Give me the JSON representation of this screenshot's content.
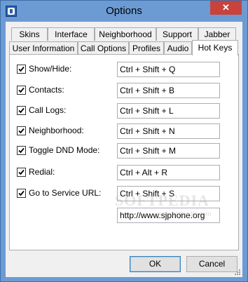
{
  "window": {
    "title": "Options",
    "close_label": "✕"
  },
  "tabs_back": [
    "Skins",
    "Interface",
    "Neighborhood",
    "Support",
    "Jabber"
  ],
  "tabs_front": [
    "User Information",
    "Call Options",
    "Profiles",
    "Audio",
    "Hot Keys"
  ],
  "active_tab": "Hot Keys",
  "hotkeys": [
    {
      "label": "Show/Hide:",
      "value": "Ctrl + Shift + Q",
      "checked": true
    },
    {
      "label": "Contacts:",
      "value": "Ctrl + Shift + B",
      "checked": true
    },
    {
      "label": "Call Logs:",
      "value": "Ctrl + Shift + L",
      "checked": true
    },
    {
      "label": "Neighborhood:",
      "value": "Ctrl + Shift + N",
      "checked": true
    },
    {
      "label": "Toggle DND Mode:",
      "value": "Ctrl + Shift + M",
      "checked": true
    },
    {
      "label": "Redial:",
      "value": "Ctrl + Alt + R",
      "checked": true
    },
    {
      "label": "Go to Service URL:",
      "value": "Ctrl + Shift + S",
      "checked": true
    }
  ],
  "service_url": "http://www.sjphone.org",
  "watermark": {
    "text": "SOFTPEDIA",
    "url": "www.softpedia.com"
  },
  "buttons": {
    "ok": "OK",
    "cancel": "Cancel"
  }
}
